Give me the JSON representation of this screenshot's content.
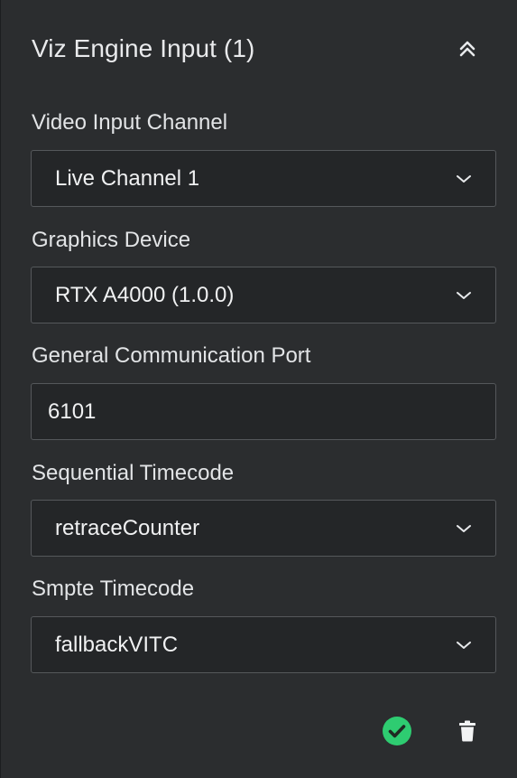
{
  "panel": {
    "title": "Viz Engine Input (1)",
    "collapse_icon": "double-chevron-up-icon"
  },
  "fields": {
    "video_input_channel": {
      "label": "Video Input Channel",
      "value": "Live Channel 1",
      "kind": "select"
    },
    "graphics_device": {
      "label": "Graphics Device",
      "value": "RTX A4000 (1.0.0)",
      "kind": "select"
    },
    "general_communication_port": {
      "label": "General Communication Port",
      "value": "6101",
      "kind": "input"
    },
    "sequential_timecode": {
      "label": "Sequential Timecode",
      "value": "retraceCounter",
      "kind": "select"
    },
    "smpte_timecode": {
      "label": "Smpte Timecode",
      "value": "fallbackVITC",
      "kind": "select"
    }
  },
  "actions": {
    "confirm_icon": "check-circle-icon",
    "delete_icon": "trash-icon"
  },
  "colors": {
    "panel_background": "#2b2d2f",
    "field_background": "#242628",
    "field_border": "#55585b",
    "text": "#e6e8ea",
    "success": "#2ecc71"
  }
}
